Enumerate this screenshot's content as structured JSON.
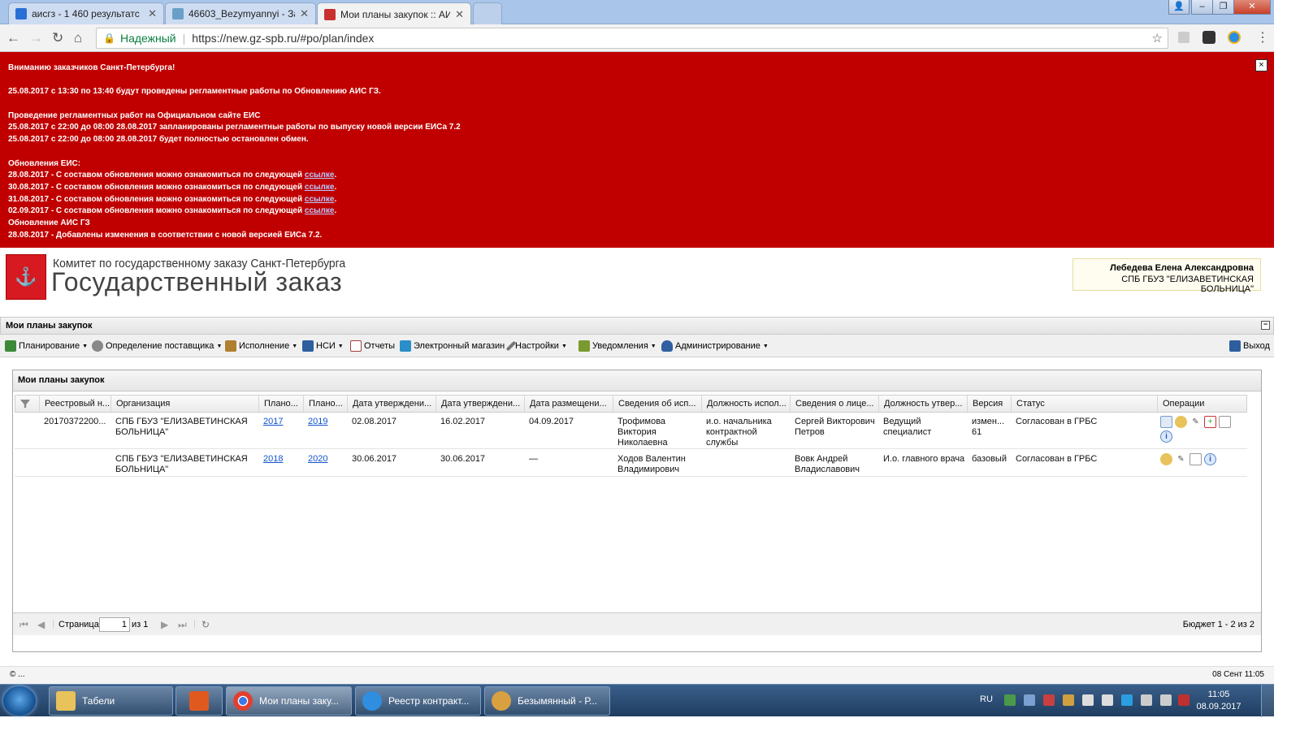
{
  "browser": {
    "tabs": [
      {
        "title": "аисгз - 1 460 результатс",
        "active": false
      },
      {
        "title": "46603_Bezymyannyi - За",
        "active": false
      },
      {
        "title": "Мои планы закупок :: АИ",
        "active": true
      }
    ],
    "secure_label": "Надежный",
    "url": "https://new.gz-spb.ru/#po/plan/index"
  },
  "banner": {
    "lines": [
      "Вниманию заказчиков Санкт-Петербурга!",
      "",
      "25.08.2017 с 13:30 по 13:40 будут проведены регламентные работы по Обновлению АИС ГЗ.",
      "",
      "Проведение регламентных работ на Официальном сайте ЕИС",
      "25.08.2017 с 22:00 до 08:00 28.08.2017 запланированы регламентные работы по выпуску новой версии ЕИСа 7.2",
      "25.08.2017 с 22:00 до 08:00 28.08.2017 будет полностью остановлен обмен.",
      "",
      "Обновления ЕИС:"
    ],
    "update_prefix_lines": [
      "28.08.2017 - С составом обновления можно ознакомиться по следующей ",
      "30.08.2017 - С составом обновления можно ознакомиться по следующей ",
      "31.08.2017 - С составом обновления можно ознакомиться по следующей ",
      "02.09.2017 - С составом обновления можно ознакомиться по следующей "
    ],
    "link_label": "ссылке",
    "period": ".",
    "tail_lines": [
      " Обновление АИС ГЗ",
      "28.08.2017 - Добавлены изменения в соответствии с новой версией ЕИСа 7.2."
    ],
    "close": "×"
  },
  "header": {
    "org_line1": "Комитет по государственному заказу Санкт-Петербурга",
    "org_line2": "Государственный заказ",
    "user_name": "Лебедева Елена Александровна",
    "user_org": "СПБ ГБУЗ \"ЕЛИЗАВЕТИНСКАЯ БОЛЬНИЦА\""
  },
  "panel": {
    "title": "Мои планы закупок"
  },
  "toolbar": {
    "items": [
      {
        "label": "Планирование",
        "dropdown": true,
        "icon": "planning-icon",
        "color": "#3a8a3a"
      },
      {
        "label": "Определение поставщика",
        "dropdown": true,
        "icon": "gear-icon",
        "color": "#666666"
      },
      {
        "label": "Исполнение",
        "dropdown": true,
        "icon": "briefcase-icon",
        "color": "#b08030"
      },
      {
        "label": "НСИ",
        "dropdown": true,
        "icon": "book-icon",
        "color": "#2d5f9e"
      },
      {
        "label": "Отчеты",
        "dropdown": false,
        "icon": "report-icon",
        "color": "#a04040"
      },
      {
        "label": "Электронный магазин",
        "dropdown": false,
        "icon": "cart-icon",
        "color": "#2a8fc8"
      },
      {
        "label": "Настройки",
        "dropdown": true,
        "icon": "wrench-icon",
        "color": "#555555"
      },
      {
        "label": "Уведомления",
        "dropdown": true,
        "icon": "envelope-icon",
        "color": "#7a9a30"
      },
      {
        "label": "Администрирование",
        "dropdown": true,
        "icon": "user-icon",
        "color": "#3060a0"
      }
    ],
    "exit_label": "Выход"
  },
  "grid": {
    "title": "Мои планы закупок",
    "columns": [
      "",
      "Реестровый н...",
      "Организация",
      "Плано...",
      "Плано...",
      "Дата утверждени...",
      "Дата утверждени...",
      "Дата размещени...",
      "Сведения об исп...",
      "Должность испол...",
      "Сведения о лице...",
      "Должность утвер...",
      "Версия",
      "Статус",
      "Операции"
    ],
    "rows": [
      {
        "reg": "20170372200...",
        "org": "СПБ ГБУЗ \"ЕЛИЗАВЕТИНСКАЯ БОЛЬНИЦА\"",
        "plan_from": "2017",
        "plan_to": "2019",
        "approve1": "02.08.2017",
        "approve2": "16.02.2017",
        "placed": "04.09.2017",
        "executor": "Трофимова Виктория Николаевна",
        "executor_pos": "и.о. начальника контрактной службы",
        "approver": "Сергей Викторович Петров",
        "approver_pos": "Ведущий специалист",
        "version": "измен... 61",
        "status": "Согласован в ГРБС"
      },
      {
        "reg": "",
        "org": "СПБ ГБУЗ \"ЕЛИЗАВЕТИНСКАЯ БОЛЬНИЦА\"",
        "plan_from": "2018",
        "plan_to": "2020",
        "approve1": "30.06.2017",
        "approve2": "30.06.2017",
        "placed": "—",
        "executor": "Ходов Валентин Владимирович",
        "executor_pos": "",
        "approver": "Вовк Андрей Владиславович",
        "approver_pos": "И.о. главного врача",
        "version": "базовый",
        "status": "Согласован в ГРБС"
      }
    ],
    "pager": {
      "page_label": "Страница",
      "page": "1",
      "of_label": "из 1",
      "summary": "Бюджет 1 - 2 из 2"
    }
  },
  "status_bar": {
    "left": "© ...",
    "right": "08 Сент 11:05"
  },
  "taskbar": {
    "items": [
      {
        "label": "Табели",
        "icon": "folder-icon",
        "color": "#e8c25a"
      },
      {
        "label": "",
        "icon": "paint-app-icon",
        "color": "#e05a20"
      },
      {
        "label": "Мои планы заку...",
        "icon": "chrome-icon",
        "color": "#e04030"
      },
      {
        "label": "Реестр контракт...",
        "icon": "ie-icon",
        "color": "#2f8ee0"
      },
      {
        "label": "Безымянный - Р...",
        "icon": "paint-icon",
        "color": "#d8a040"
      }
    ],
    "lang": "RU",
    "time": "11:05",
    "date": "08.09.2017"
  }
}
